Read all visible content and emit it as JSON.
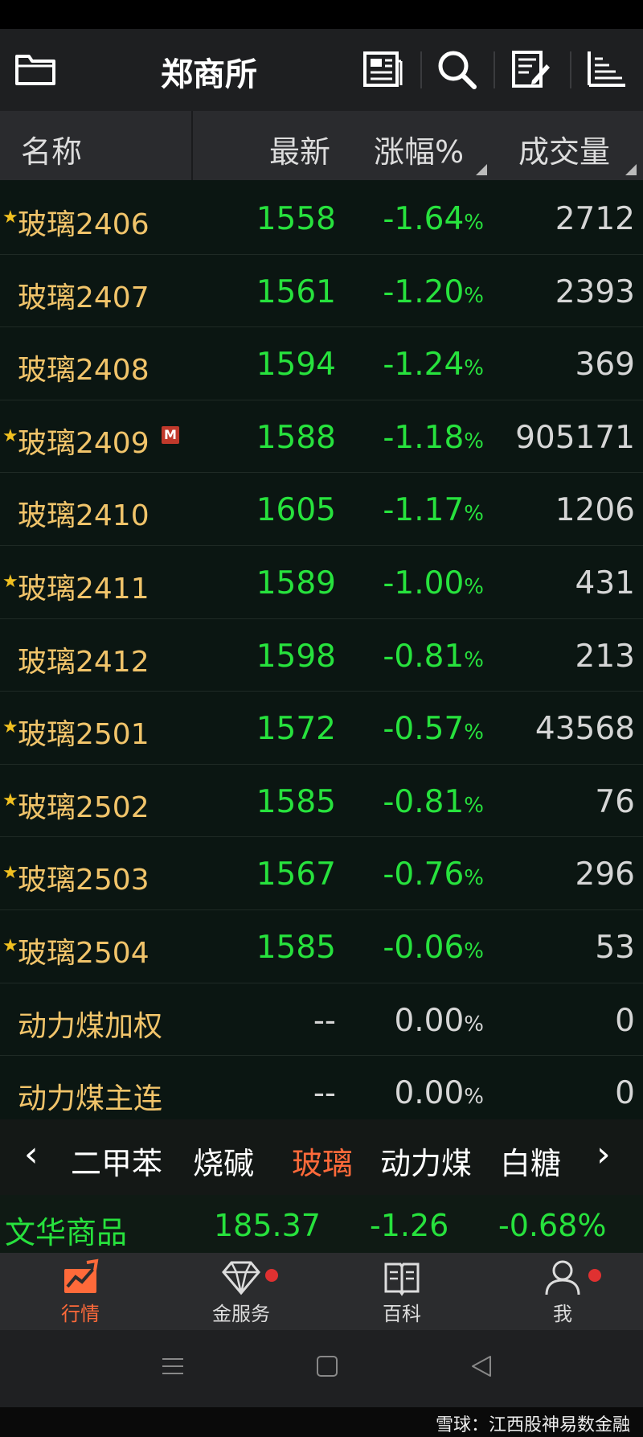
{
  "header_bar": {
    "title": "郑商所"
  },
  "columns": {
    "name": "名称",
    "latest": "最新",
    "change": "涨幅%",
    "volume": "成交量"
  },
  "rows": [
    {
      "starred": true,
      "name": "玻璃2406",
      "latest": "1558",
      "change": "-1.64",
      "volume": "2712"
    },
    {
      "starred": false,
      "name": "玻璃2407",
      "latest": "1561",
      "change": "-1.20",
      "volume": "2393"
    },
    {
      "starred": false,
      "name": "玻璃2408",
      "latest": "1594",
      "change": "-1.24",
      "volume": "369"
    },
    {
      "starred": true,
      "name": "玻璃2409",
      "badge": "M",
      "latest": "1588",
      "change": "-1.18",
      "volume": "905171"
    },
    {
      "starred": false,
      "name": "玻璃2410",
      "latest": "1605",
      "change": "-1.17",
      "volume": "1206"
    },
    {
      "starred": true,
      "name": "玻璃2411",
      "latest": "1589",
      "change": "-1.00",
      "volume": "431"
    },
    {
      "starred": false,
      "name": "玻璃2412",
      "latest": "1598",
      "change": "-0.81",
      "volume": "213"
    },
    {
      "starred": true,
      "name": "玻璃2501",
      "latest": "1572",
      "change": "-0.57",
      "volume": "43568"
    },
    {
      "starred": true,
      "name": "玻璃2502",
      "latest": "1585",
      "change": "-0.81",
      "volume": "76"
    },
    {
      "starred": true,
      "name": "玻璃2503",
      "latest": "1567",
      "change": "-0.76",
      "volume": "296"
    },
    {
      "starred": true,
      "name": "玻璃2504",
      "latest": "1585",
      "change": "-0.06",
      "volume": "53"
    },
    {
      "starred": false,
      "name": "动力煤加权",
      "latest": "--",
      "change": "0.00",
      "volume": "0",
      "neutral": true
    },
    {
      "starred": false,
      "name": "动力煤主连",
      "latest": "--",
      "change": "0.00",
      "volume": "0",
      "neutral": true
    }
  ],
  "pct_symbol": "%",
  "category_tabs": [
    "二甲苯",
    "烧碱",
    "玻璃",
    "动力煤",
    "白糖"
  ],
  "active_tab": "玻璃",
  "index": {
    "name": "文华商品",
    "value": "185.37",
    "change": "-1.26",
    "change_pct": "-0.68%"
  },
  "bottom_nav": [
    {
      "label": "行情",
      "icon": "market-chart-icon",
      "active": true
    },
    {
      "label": "金服务",
      "icon": "diamond-icon",
      "badge_dot": true
    },
    {
      "label": "百科",
      "icon": "book-icon"
    },
    {
      "label": "我",
      "icon": "person-icon",
      "badge_dot": true
    }
  ],
  "watermark": "雪球：江西股神易数金融",
  "colors": {
    "up_down_green": "#27e23d",
    "name_gold": "#f1c46a",
    "accent": "#ff6a3a",
    "star": "#f0c020"
  }
}
